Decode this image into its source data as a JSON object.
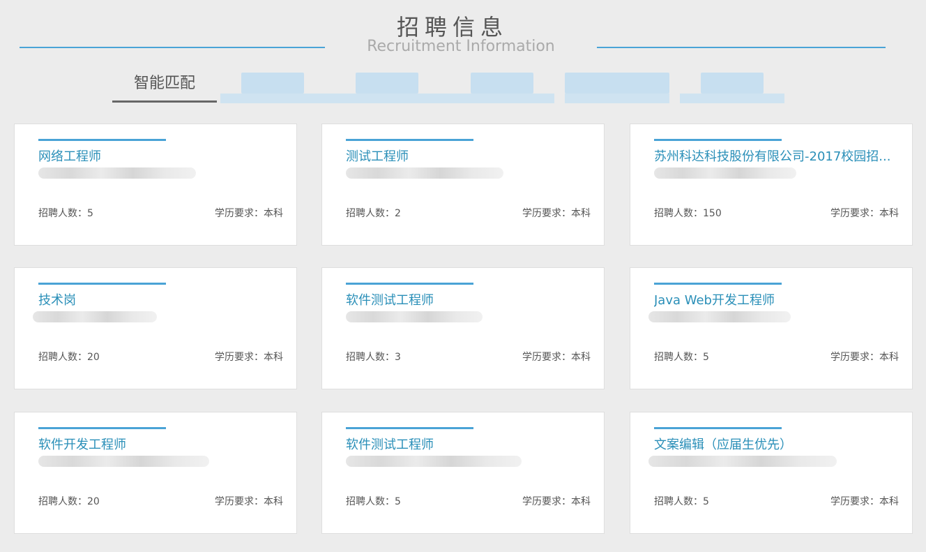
{
  "header": {
    "title_cn": "招聘信息",
    "title_en": "Recruitment Information"
  },
  "tabs": {
    "active": "智能匹配",
    "others_redacted": 5
  },
  "jobs": [
    {
      "title": "网络工程师",
      "count_label": "招聘人数：5",
      "edu_label": "学历要求：本科"
    },
    {
      "title": "测试工程师",
      "count_label": "招聘人数：2",
      "edu_label": "学历要求：本科"
    },
    {
      "title": "苏州科达科技股份有限公司-2017校园招...",
      "count_label": "招聘人数：150",
      "edu_label": "学历要求：本科"
    },
    {
      "title": "技术岗",
      "count_label": "招聘人数：20",
      "edu_label": "学历要求：本科"
    },
    {
      "title": "软件测试工程师",
      "count_label": "招聘人数：3",
      "edu_label": "学历要求：本科"
    },
    {
      "title": "Java Web开发工程师",
      "count_label": "招聘人数：5",
      "edu_label": "学历要求：本科"
    },
    {
      "title": "软件开发工程师",
      "count_label": "招聘人数：20",
      "edu_label": "学历要求：本科"
    },
    {
      "title": "软件测试工程师",
      "count_label": "招聘人数：5",
      "edu_label": "学历要求：本科"
    },
    {
      "title": "文案编辑（应届生优先）",
      "count_label": "招聘人数：5",
      "edu_label": "学历要求：本科"
    }
  ],
  "colors": {
    "accent": "#4aa3d6",
    "job_title": "#2a8fb8",
    "background": "#ececec"
  }
}
